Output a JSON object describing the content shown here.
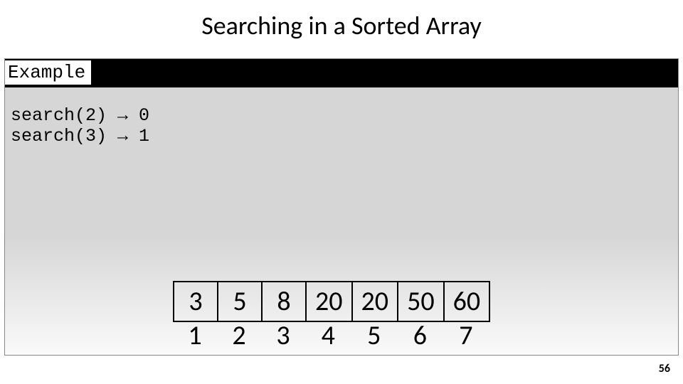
{
  "title": "Searching in a Sorted Array",
  "example_label": "Example",
  "code": {
    "line1": "search(2) → 0",
    "line2": "search(3) → 1"
  },
  "array": {
    "values": [
      "3",
      "5",
      "8",
      "20",
      "20",
      "50",
      "60"
    ],
    "indices": [
      "1",
      "2",
      "3",
      "4",
      "5",
      "6",
      "7"
    ]
  },
  "page_number": "56"
}
